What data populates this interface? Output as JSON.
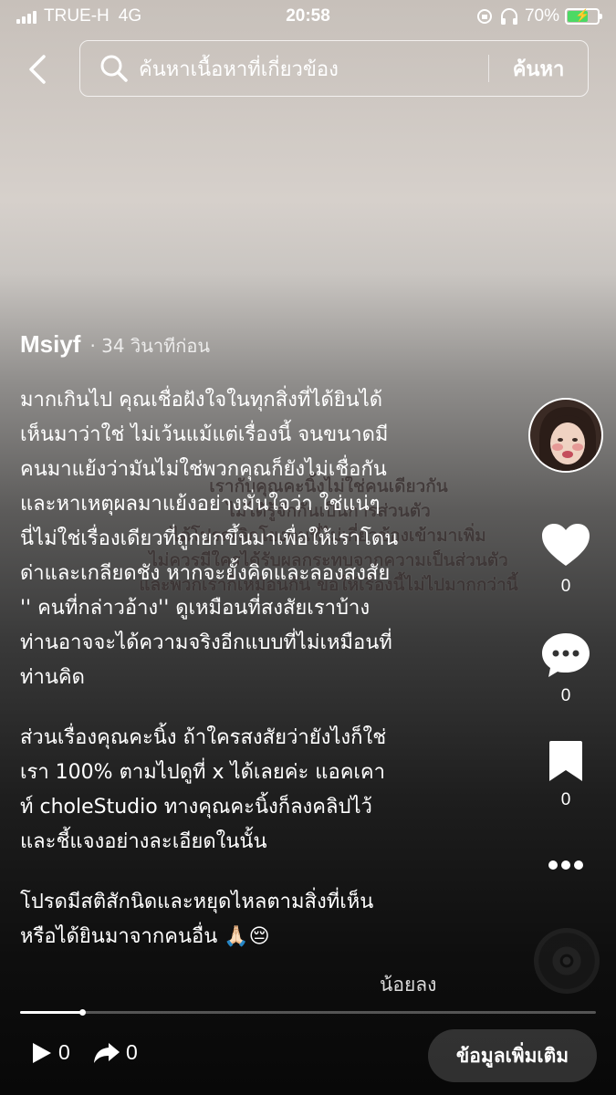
{
  "status_bar": {
    "carrier": "TRUE-H",
    "network": "4G",
    "time": "20:58",
    "battery": "70%",
    "battery_level": 0.7,
    "battery_color": "#4cd964"
  },
  "search": {
    "query": "ค้นหาเนื้อหาที่เกี่ยวข้อง",
    "submit_label": "ค้นหา"
  },
  "post": {
    "author": "Msiyf",
    "time_ago": "· 34 วินาทีก่อน",
    "caption_paragraphs": [
      "มากเกินไป คุณเชื่อฝังใจในทุกสิ่งที่ได้ยินได้\nเห็นมาว่าใช่ ไม่เว้นแม้แต่เรื่องนี้ จนขนาดมี\nคนมาแย้งว่ามันไม่ใช่พวกคุณก็ยังไม่เชื่อกัน\nและหาเหตุผลมาแย้งอย่างมั่นใจว่า ใช่แน่ๆ\nนี่ไม่ใช่เรื่องเดียวที่ถูกยกขึ้นมาเพื่อให้เราโดน\nด่าและเกลียดชัง หากจะยั้งคิดและลองสงสัย\n'' คนที่กล่าวอ้าง'' ดูเหมือนที่สงสัยเราบ้าง\nท่านอาจจะได้ความจริงอีกแบบที่ไม่เหมือนที่\nท่านคิด",
      "ส่วนเรื่องคุณคะนิ้ง ถ้าใครสงสัยว่ายังไงก็ใช่\nเรา 100% ตามไปดูที่ x ได้เลยค่ะ แอคเคา\nท์ choleStudio ทางคุณคะนิ้งก็ลงคลิปไว้\nและชี้แจงอย่างละเอียดในนั้น",
      "โปรดมีสติสักนิดและหยุดไหลตามสิ่งที่เห็น\nหรือได้ยินมาจากคนอื่น 🙏🏻😔"
    ],
    "see_less": "น้อยลง",
    "video_overlay_lines": [
      "เรากับคุณคะนิ้งไม่ใช่คนเดียวกัน",
      "ไม่ได้รู้จักกันเป็นการส่วนตัว",
      "ได้โปรดเลิกโยงคนที่ไม่เกี่ยวข้องเข้ามาเพิ่ม",
      "ไม่ควรมีใครได้รับผลกระทบจากความเป็นส่วนตัว",
      "และพวกเราก็เหมือนกัน ขอให้เรื่องนี้ไม่ไปมากกว่านี้"
    ],
    "playback_progress": 0.11
  },
  "actions": {
    "likes": "0",
    "comments": "0",
    "saves": "0"
  },
  "bottom": {
    "plays": "0",
    "shares": "0",
    "more_info": "ข้อมูลเพิ่มเติม"
  }
}
